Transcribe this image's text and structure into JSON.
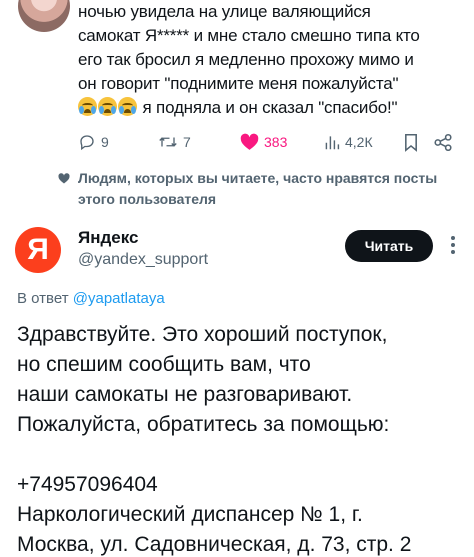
{
  "tweet": {
    "lines": [
      "ночью увидела на улице валяющийся",
      "самокат Я***** и мне стало смешно типа кто",
      "его так бросил я медленно прохожу мимо и",
      "он говорит \"поднимите меня пожалуйста\"",
      "я подняла и он сказал \"спасибо!\""
    ],
    "emoji_icon": "loudly-crying-face-icon",
    "actions": {
      "replies": "9",
      "retweets": "7",
      "likes": "383",
      "views": "4,2К"
    }
  },
  "recommendation": {
    "text": "Людям, которых вы читаете, часто нравятся посты этого пользователя"
  },
  "reply": {
    "avatar_letter": "Я",
    "name": "Яндекс",
    "handle": "@yandex_support",
    "read_button": "Читать",
    "reply_prefix": "В ответ",
    "reply_to": "@yapatlataya",
    "body": [
      "Здравствуйте. Это хороший поступок,",
      "но спешим сообщить вам, что",
      "наши самокаты не разговаривают.",
      "Пожалуйста, обратитесь за помощью:",
      "",
      "+74957096404",
      "Наркологический диспансер № 1, г.",
      "Москва, ул. Садовническая, д. 73, стр. 2"
    ]
  },
  "colors": {
    "accent": "#1d9bf0",
    "like": "#f91880",
    "yandex_red": "#fc3f1d",
    "muted": "#536471"
  }
}
